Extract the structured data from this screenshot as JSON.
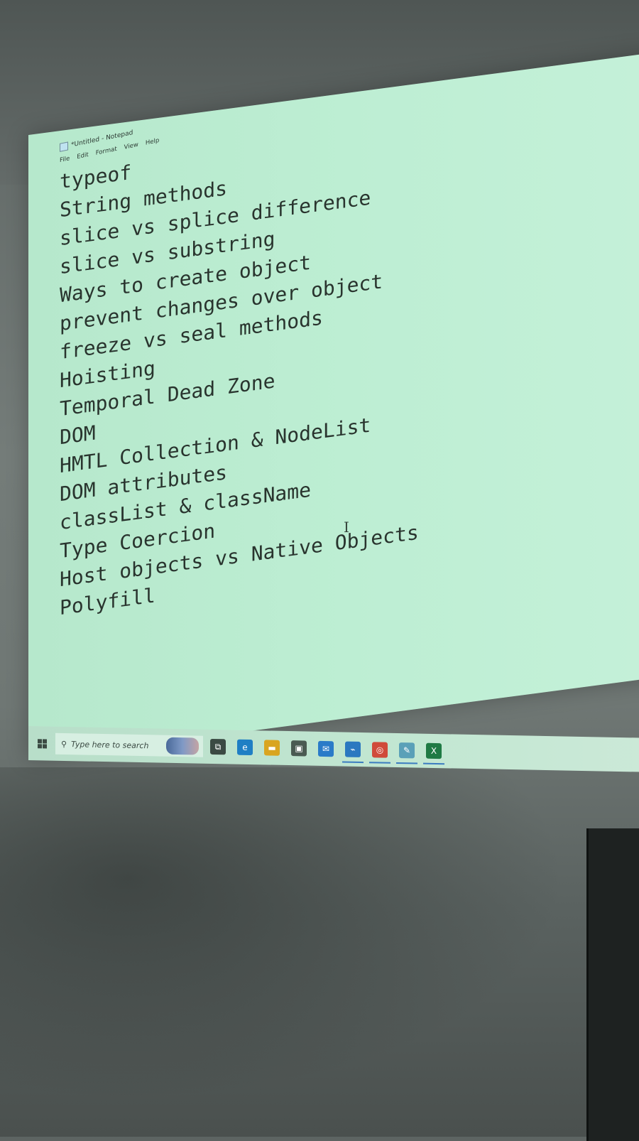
{
  "window": {
    "title": "*Untitled - Notepad",
    "menu": [
      "File",
      "Edit",
      "Format",
      "View",
      "Help"
    ]
  },
  "editor": {
    "lines": [
      "typeof",
      "String methods",
      "slice vs splice difference",
      "slice vs substring",
      "Ways to create object",
      "prevent changes over object",
      "freeze vs seal methods",
      "Hoisting",
      "Temporal Dead Zone",
      "DOM",
      "HMTL Collection & NodeList",
      "DOM attributes",
      "classList & className",
      "Type Coercion",
      "Host objects vs Native Objects",
      "Polyfill"
    ],
    "cursor_glyph": "I"
  },
  "taskbar": {
    "search_placeholder": "Type here to search",
    "search_icon_glyph": "⚲",
    "icons": [
      {
        "name": "task-view-icon",
        "glyph": "⧉",
        "color": "#3b4a43"
      },
      {
        "name": "edge-icon",
        "glyph": "e",
        "color": "#1f7fc4"
      },
      {
        "name": "file-explorer-icon",
        "glyph": "▬",
        "color": "#d9a520"
      },
      {
        "name": "store-icon",
        "glyph": "▣",
        "color": "#4a5a52"
      },
      {
        "name": "mail-icon",
        "glyph": "✉",
        "color": "#2a7bc8"
      },
      {
        "name": "vscode-icon",
        "glyph": "⌁",
        "color": "#2b78c0"
      },
      {
        "name": "chrome-icon",
        "glyph": "◎",
        "color": "#d04a3a"
      },
      {
        "name": "notepad-icon",
        "glyph": "✎",
        "color": "#5aa0b8"
      },
      {
        "name": "excel-icon",
        "glyph": "X",
        "color": "#1f7a44"
      }
    ]
  }
}
